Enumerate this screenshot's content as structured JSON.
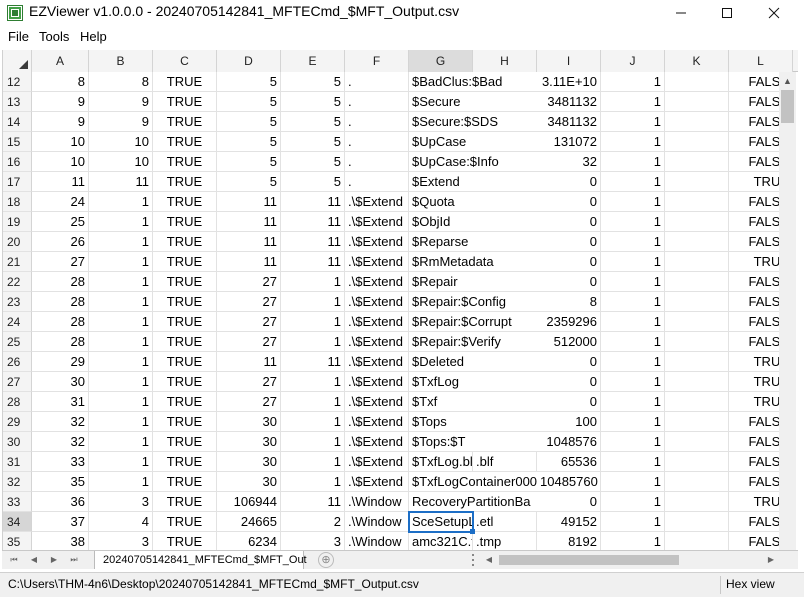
{
  "window": {
    "title": "EZViewer v1.0.0.0 - 20240705142841_MFTECmd_$MFT_Output.csv",
    "minimize": "—",
    "maximize": "☐",
    "close": "✕"
  },
  "menu": [
    "File",
    "Tools",
    "Help"
  ],
  "columns": [
    "A",
    "B",
    "C",
    "D",
    "E",
    "F",
    "G",
    "H",
    "I",
    "J",
    "K",
    "L"
  ],
  "selected_column": "G",
  "selected_row": "34",
  "rows": [
    {
      "n": "12",
      "A": "8",
      "B": "8",
      "C": "TRUE",
      "D": "5",
      "E": "5",
      "F": ".",
      "G": "$BadClus:$Bad",
      "I": "3.11E+10",
      "J": "1",
      "K": "",
      "L": "FALSE"
    },
    {
      "n": "13",
      "A": "9",
      "B": "9",
      "C": "TRUE",
      "D": "5",
      "E": "5",
      "F": ".",
      "G": "$Secure",
      "I": "3481132",
      "J": "1",
      "K": "",
      "L": "FALSE"
    },
    {
      "n": "14",
      "A": "9",
      "B": "9",
      "C": "TRUE",
      "D": "5",
      "E": "5",
      "F": ".",
      "G": "$Secure:$SDS",
      "I": "3481132",
      "J": "1",
      "K": "",
      "L": "FALSE"
    },
    {
      "n": "15",
      "A": "10",
      "B": "10",
      "C": "TRUE",
      "D": "5",
      "E": "5",
      "F": ".",
      "G": "$UpCase",
      "I": "131072",
      "J": "1",
      "K": "",
      "L": "FALSE"
    },
    {
      "n": "16",
      "A": "10",
      "B": "10",
      "C": "TRUE",
      "D": "5",
      "E": "5",
      "F": ".",
      "G": "$UpCase:$Info",
      "I": "32",
      "J": "1",
      "K": "",
      "L": "FALSE"
    },
    {
      "n": "17",
      "A": "11",
      "B": "11",
      "C": "TRUE",
      "D": "5",
      "E": "5",
      "F": ".",
      "G": "$Extend",
      "I": "0",
      "J": "1",
      "K": "",
      "L": "TRUE"
    },
    {
      "n": "18",
      "A": "24",
      "B": "1",
      "C": "TRUE",
      "D": "11",
      "E": "11",
      "F": ".\\$Extend",
      "G": "$Quota",
      "I": "0",
      "J": "1",
      "K": "",
      "L": "FALSE"
    },
    {
      "n": "19",
      "A": "25",
      "B": "1",
      "C": "TRUE",
      "D": "11",
      "E": "11",
      "F": ".\\$Extend",
      "G": "$ObjId",
      "I": "0",
      "J": "1",
      "K": "",
      "L": "FALSE"
    },
    {
      "n": "20",
      "A": "26",
      "B": "1",
      "C": "TRUE",
      "D": "11",
      "E": "11",
      "F": ".\\$Extend",
      "G": "$Reparse",
      "I": "0",
      "J": "1",
      "K": "",
      "L": "FALSE"
    },
    {
      "n": "21",
      "A": "27",
      "B": "1",
      "C": "TRUE",
      "D": "11",
      "E": "11",
      "F": ".\\$Extend",
      "G": "$RmMetadata",
      "I": "0",
      "J": "1",
      "K": "",
      "L": "TRUE"
    },
    {
      "n": "22",
      "A": "28",
      "B": "1",
      "C": "TRUE",
      "D": "27",
      "E": "1",
      "F": ".\\$Extend",
      "G": "$Repair",
      "I": "0",
      "J": "1",
      "K": "",
      "L": "FALSE"
    },
    {
      "n": "23",
      "A": "28",
      "B": "1",
      "C": "TRUE",
      "D": "27",
      "E": "1",
      "F": ".\\$Extend",
      "G": "$Repair:$Config",
      "I": "8",
      "J": "1",
      "K": "",
      "L": "FALSE"
    },
    {
      "n": "24",
      "A": "28",
      "B": "1",
      "C": "TRUE",
      "D": "27",
      "E": "1",
      "F": ".\\$Extend",
      "G": "$Repair:$Corrupt",
      "I": "2359296",
      "J": "1",
      "K": "",
      "L": "FALSE"
    },
    {
      "n": "25",
      "A": "28",
      "B": "1",
      "C": "TRUE",
      "D": "27",
      "E": "1",
      "F": ".\\$Extend",
      "G": "$Repair:$Verify",
      "I": "512000",
      "J": "1",
      "K": "",
      "L": "FALSE"
    },
    {
      "n": "26",
      "A": "29",
      "B": "1",
      "C": "TRUE",
      "D": "11",
      "E": "11",
      "F": ".\\$Extend",
      "G": "$Deleted",
      "I": "0",
      "J": "1",
      "K": "",
      "L": "TRUE"
    },
    {
      "n": "27",
      "A": "30",
      "B": "1",
      "C": "TRUE",
      "D": "27",
      "E": "1",
      "F": ".\\$Extend",
      "G": "$TxfLog",
      "I": "0",
      "J": "1",
      "K": "",
      "L": "TRUE"
    },
    {
      "n": "28",
      "A": "31",
      "B": "1",
      "C": "TRUE",
      "D": "27",
      "E": "1",
      "F": ".\\$Extend",
      "G": "$Txf",
      "I": "0",
      "J": "1",
      "K": "",
      "L": "TRUE"
    },
    {
      "n": "29",
      "A": "32",
      "B": "1",
      "C": "TRUE",
      "D": "30",
      "E": "1",
      "F": ".\\$Extend",
      "G": "$Tops",
      "I": "100",
      "J": "1",
      "K": "",
      "L": "FALSE"
    },
    {
      "n": "30",
      "A": "32",
      "B": "1",
      "C": "TRUE",
      "D": "30",
      "E": "1",
      "F": ".\\$Extend",
      "G": "$Tops:$T",
      "I": "1048576",
      "J": "1",
      "K": "",
      "L": "FALSE"
    },
    {
      "n": "31",
      "A": "33",
      "B": "1",
      "C": "TRUE",
      "D": "30",
      "E": "1",
      "F": ".\\$Extend",
      "G": "$TxfLog.bl",
      "H": ".blf",
      "I": "65536",
      "J": "1",
      "K": "",
      "L": "FALSE"
    },
    {
      "n": "32",
      "A": "35",
      "B": "1",
      "C": "TRUE",
      "D": "30",
      "E": "1",
      "F": ".\\$Extend",
      "G": "$TxfLogContainer000",
      "I": "10485760",
      "J": "1",
      "K": "",
      "L": "FALSE"
    },
    {
      "n": "33",
      "A": "36",
      "B": "3",
      "C": "TRUE",
      "D": "106944",
      "E": "11",
      "F": ".\\Window",
      "G": "RecoveryPartitionBa",
      "I": "0",
      "J": "1",
      "K": "",
      "L": "TRUE"
    },
    {
      "n": "34",
      "A": "37",
      "B": "4",
      "C": "TRUE",
      "D": "24665",
      "E": "2",
      "F": ".\\Window",
      "G": "SceSetupL",
      "H": ".etl",
      "I": "49152",
      "J": "1",
      "K": "",
      "L": "FALSE"
    },
    {
      "n": "35",
      "A": "38",
      "B": "3",
      "C": "TRUE",
      "D": "6234",
      "E": "3",
      "F": ".\\Window",
      "G": "amc321C.t",
      "H": ".tmp",
      "I": "8192",
      "J": "1",
      "K": "",
      "L": "FALSE"
    }
  ],
  "sheet_tab": "20240705142841_MFTECmd_$MFT_Out",
  "status": {
    "path": "C:\\Users\\THM-4n6\\Desktop\\20240705142841_MFTECmd_$MFT_Output.csv",
    "hex_view": "Hex view"
  }
}
